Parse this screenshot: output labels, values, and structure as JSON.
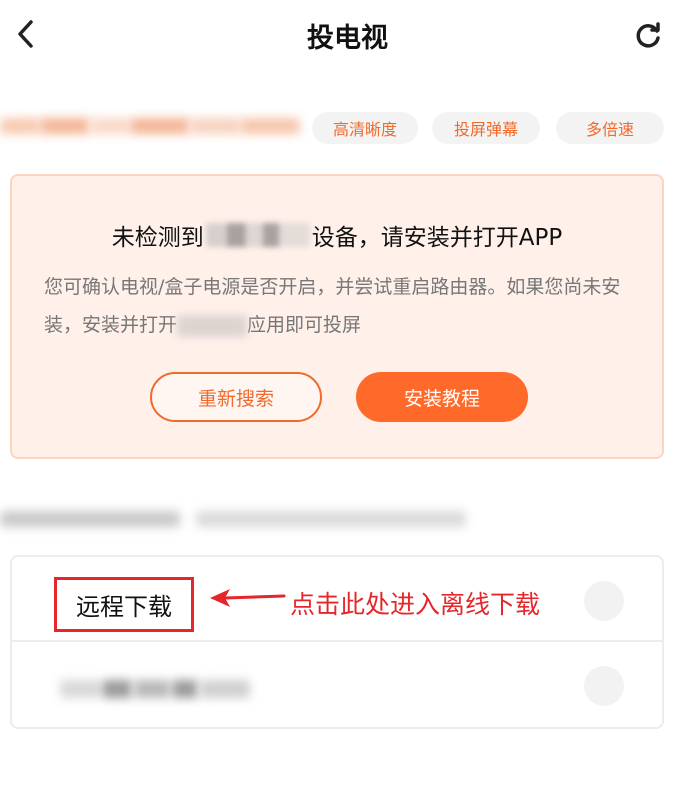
{
  "header": {
    "back_icon": "chevron-left-icon",
    "title": "投电视",
    "refresh_icon": "refresh-icon"
  },
  "tags": [
    "高清晰度",
    "投屏弹幕",
    "多倍速"
  ],
  "prompt_card": {
    "title_prefix": "未检测到",
    "title_suffix": "设备，请安装并打开APP",
    "desc_prefix": "您可确认电视/盒子电源是否开启，并尝试重启路由器。如果您尚未安装，安装并打开",
    "desc_suffix": "应用即可投屏",
    "rescan_button": "重新搜索",
    "tutorial_button": "安装教程"
  },
  "options": {
    "remote_download": "远程下载",
    "annotation": "点击此处进入离线下载"
  },
  "colors": {
    "accent": "#ff6a2a",
    "annotation_red": "#e5262b",
    "card_bg": "#fff0ea"
  }
}
